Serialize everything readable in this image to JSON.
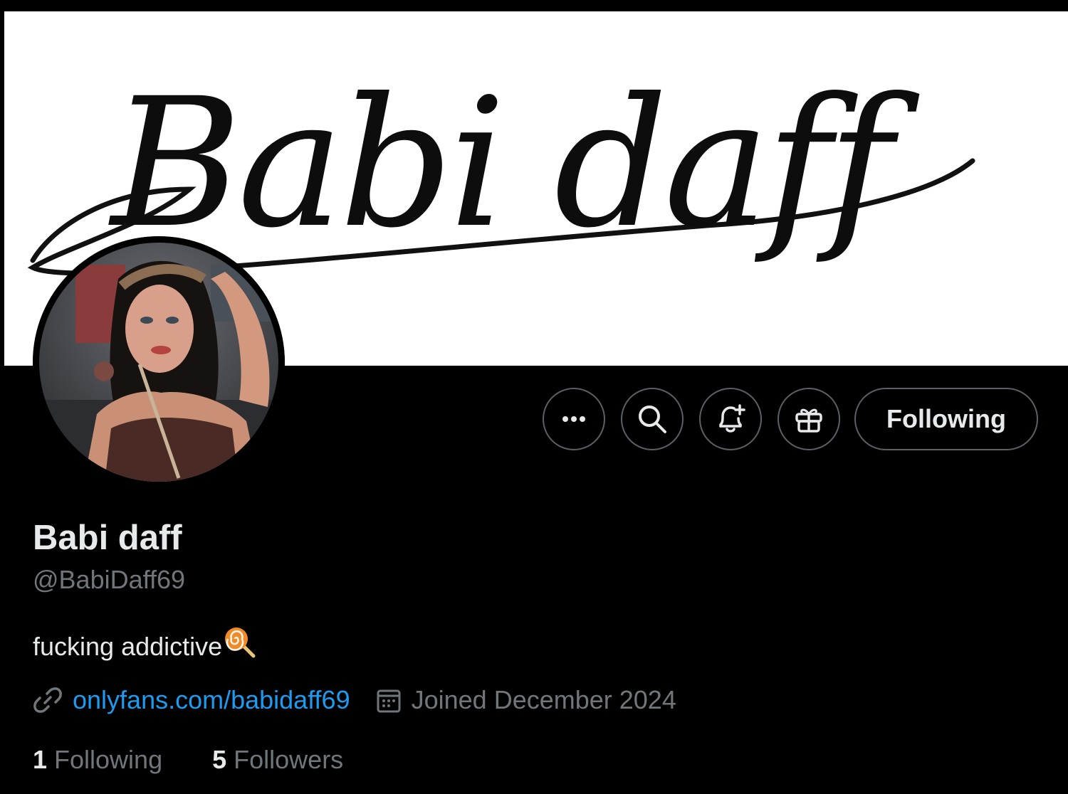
{
  "profile": {
    "banner_text": "Babi daff",
    "display_name": "Babi daff",
    "handle": "@BabiDaff69",
    "bio": "fucking addictive",
    "bio_emoji": "lollipop-icon",
    "link": "onlyfans.com/babidaff69",
    "joined": "Joined December 2024"
  },
  "actions": {
    "more_icon": "more-icon",
    "search_icon": "search-icon",
    "notify_icon": "bell-plus-icon",
    "gift_icon": "gift-icon",
    "follow_label": "Following"
  },
  "stats": {
    "following_count": "1",
    "following_label": "Following",
    "followers_count": "5",
    "followers_label": "Followers"
  },
  "colors": {
    "background": "#000000",
    "text_primary": "#e7e9ea",
    "text_secondary": "#71767b",
    "link": "#1d9bf0",
    "button_border": "#5b6066"
  }
}
